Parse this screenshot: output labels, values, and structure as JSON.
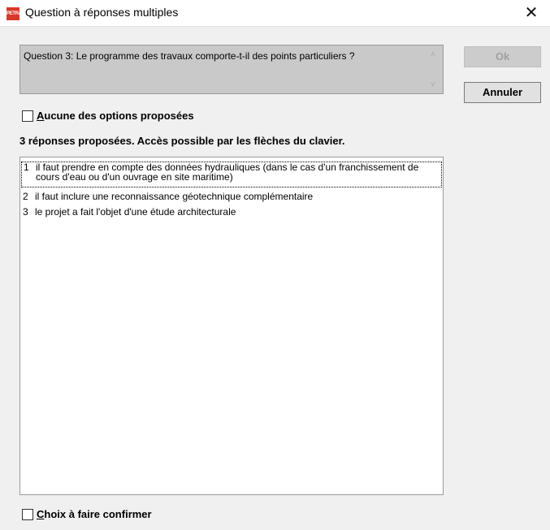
{
  "window": {
    "title": "Question à réponses multiples",
    "icon_label": "PETRA",
    "close_glyph": "✕"
  },
  "question": {
    "text": "Question 3: Le programme des travaux comporte-t-il des points particuliers ?",
    "scroll_up_glyph": "˄",
    "scroll_down_glyph": "˅"
  },
  "buttons": {
    "ok_label": "Ok",
    "cancel_label": "Annuler"
  },
  "options": {
    "none_label_accel": "A",
    "none_label_rest": "ucune des options proposées",
    "none_checked": false,
    "info": "3 réponses proposées. Accès possible par les flèches du clavier.",
    "confirm_label_accel": "C",
    "confirm_label_rest": "hoix à faire confirmer",
    "confirm_checked": false
  },
  "answers": [
    {
      "num": "1",
      "text": "il faut prendre en compte des données hydrauliques (dans le cas d'un franchissement de cours d'eau ou d'un ouvrage en site maritime)"
    },
    {
      "num": "2",
      "text": "il faut inclure une reconnaissance géotechnique complémentaire"
    },
    {
      "num": "3",
      "text": "le projet a fait l'objet d'une étude architecturale"
    }
  ]
}
